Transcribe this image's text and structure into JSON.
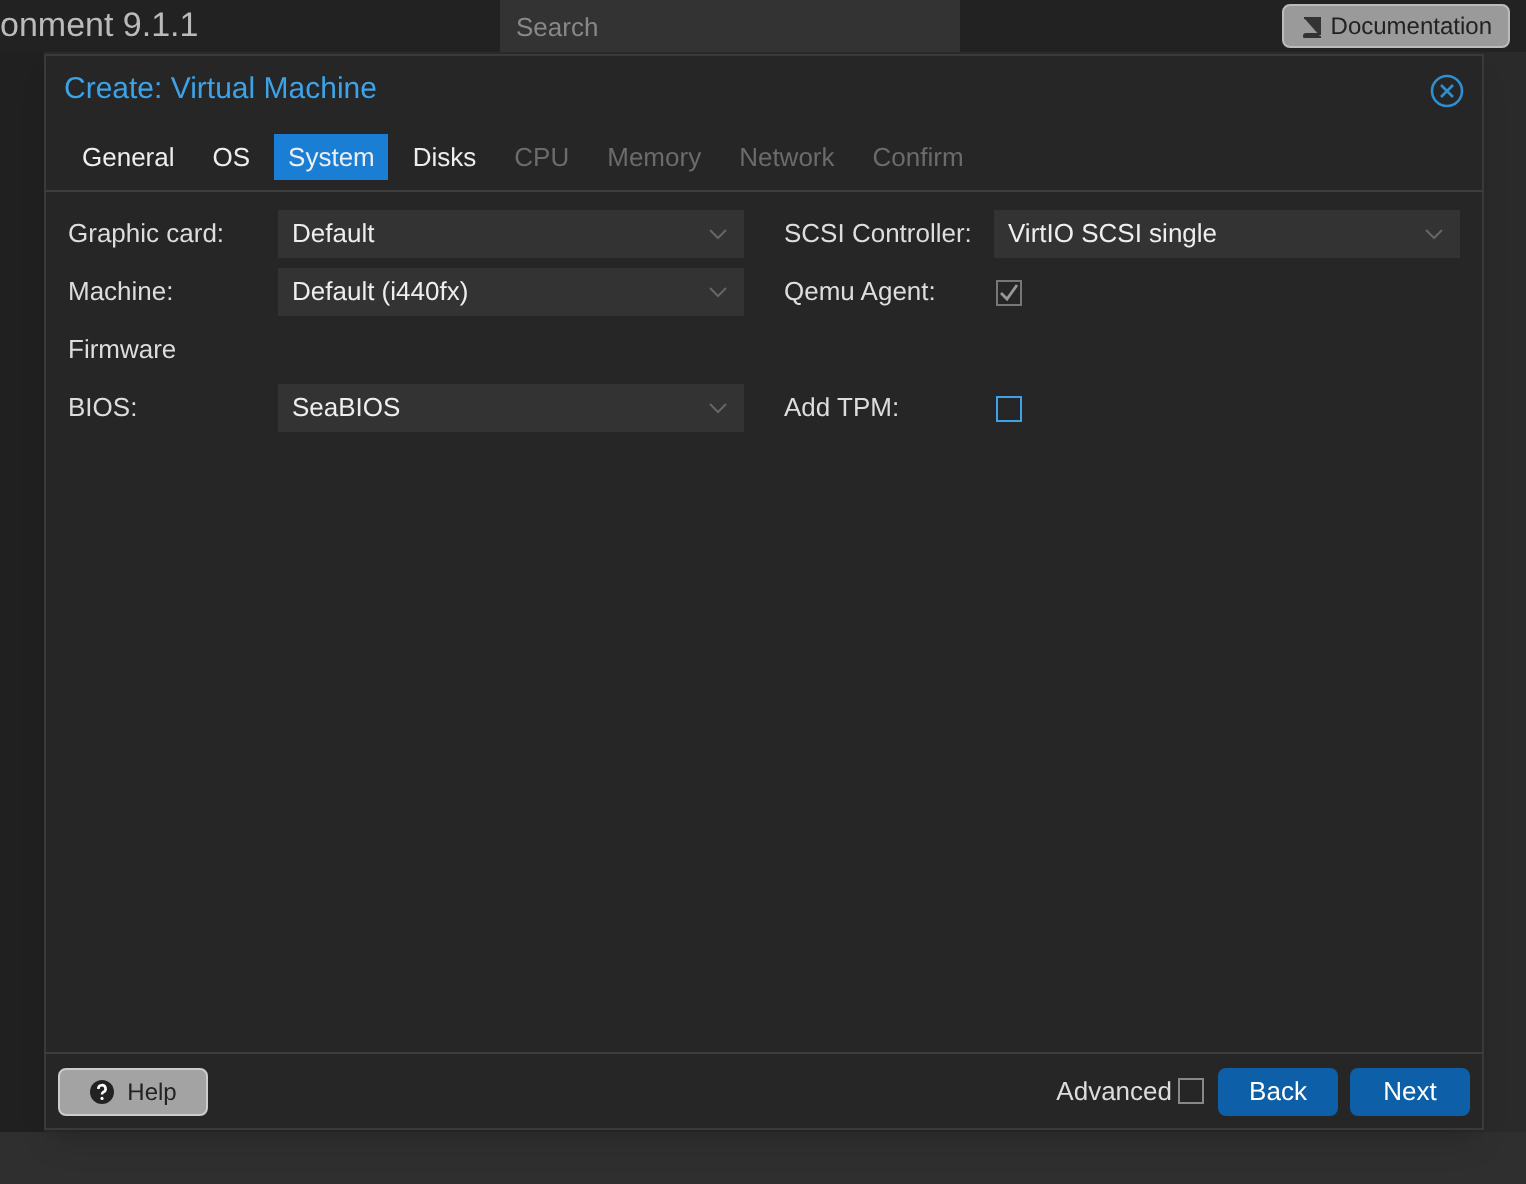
{
  "background": {
    "app_title": "onment 9.1.1",
    "search": {
      "placeholder": "Search"
    },
    "documentation_button": "Documentation"
  },
  "dialog": {
    "title": "Create: Virtual Machine",
    "tabs": [
      {
        "label": "General",
        "selected": false,
        "disabled": false
      },
      {
        "label": "OS",
        "selected": false,
        "disabled": false
      },
      {
        "label": "System",
        "selected": true,
        "disabled": false
      },
      {
        "label": "Disks",
        "selected": false,
        "disabled": false
      },
      {
        "label": "CPU",
        "selected": false,
        "disabled": true
      },
      {
        "label": "Memory",
        "selected": false,
        "disabled": true
      },
      {
        "label": "Network",
        "selected": false,
        "disabled": true
      },
      {
        "label": "Confirm",
        "selected": false,
        "disabled": true
      }
    ],
    "left_fields": [
      {
        "kind": "select",
        "label": "Graphic card:",
        "value": "Default"
      },
      {
        "kind": "select",
        "label": "Machine:",
        "value": "Default (i440fx)"
      },
      {
        "kind": "heading",
        "label": "Firmware"
      },
      {
        "kind": "select",
        "label": "BIOS:",
        "value": "SeaBIOS"
      }
    ],
    "right_fields": [
      {
        "kind": "select",
        "label": "SCSI Controller:",
        "value": "VirtIO SCSI single"
      },
      {
        "kind": "checkbox",
        "label": "Qemu Agent:",
        "checked": true,
        "focused": false
      },
      {
        "kind": "spacer"
      },
      {
        "kind": "checkbox",
        "label": "Add TPM:",
        "checked": false,
        "focused": true
      }
    ],
    "footer": {
      "help_button": "Help",
      "advanced": {
        "label": "Advanced",
        "checked": false
      },
      "buttons": [
        "Back",
        "Next"
      ]
    }
  }
}
